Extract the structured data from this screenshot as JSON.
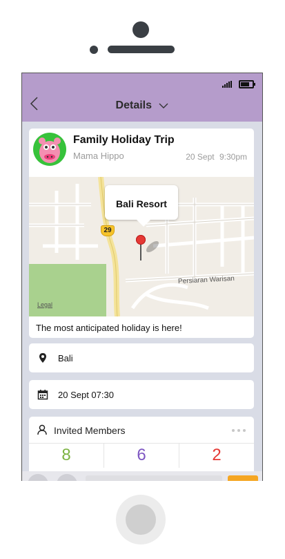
{
  "header": {
    "title": "Details"
  },
  "event": {
    "title": "Family Holiday Trip",
    "author": "Mama Hippo",
    "date": "20 Sept",
    "time": "9:30pm",
    "description": "The most anticipated holiday is here!"
  },
  "map": {
    "marker_label": "Bali Resort",
    "road_number": "29",
    "street_name": "Persiaran Warisan",
    "legal_link": "Legal"
  },
  "location": {
    "value": "Bali"
  },
  "schedule": {
    "value": "20 Sept 07:30"
  },
  "members": {
    "label": "Invited Members",
    "counts": [
      {
        "value": "8",
        "color": "#7cb342"
      },
      {
        "value": "6",
        "color": "#7e57c2"
      },
      {
        "value": "2",
        "color": "#e53935"
      }
    ]
  },
  "colors": {
    "header": "#b59ccb",
    "accent": "#f5a623"
  }
}
